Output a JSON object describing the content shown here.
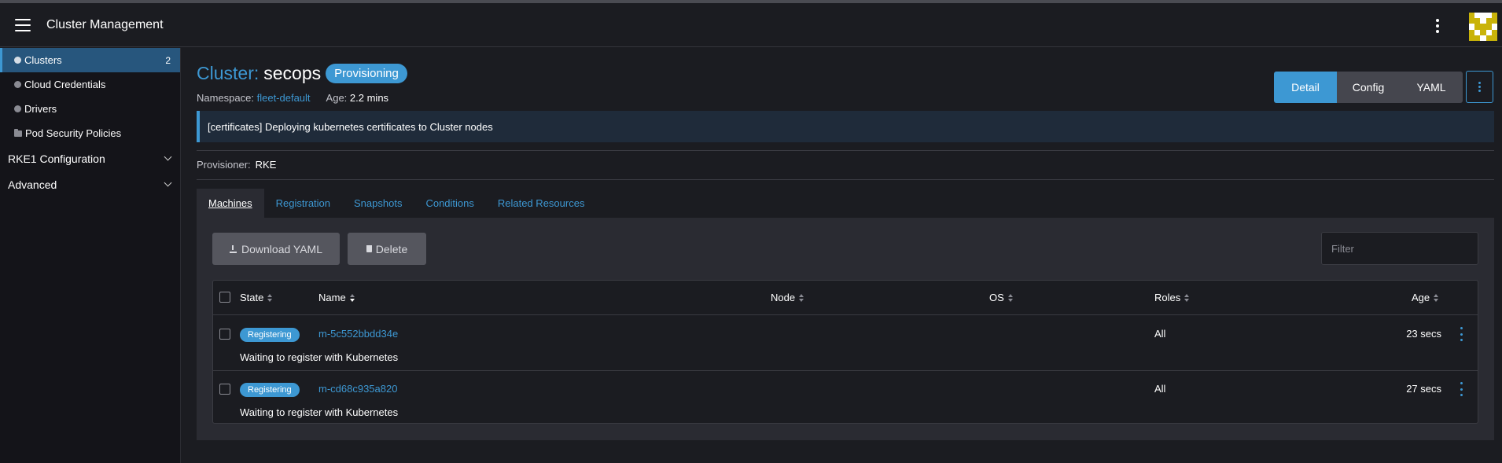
{
  "header": {
    "app_title": "Cluster Management"
  },
  "sidebar": {
    "items": [
      {
        "label": "Clusters",
        "count": "2"
      },
      {
        "label": "Cloud Credentials"
      },
      {
        "label": "Drivers"
      },
      {
        "label": "Pod Security Policies"
      }
    ],
    "groups": [
      {
        "label": "RKE1 Configuration"
      },
      {
        "label": "Advanced"
      }
    ]
  },
  "page": {
    "title_prefix": "Cluster:",
    "title_name": "secops",
    "state": "Provisioning",
    "namespace_label": "Namespace:",
    "namespace_value": "fleet-default",
    "age_label": "Age:",
    "age_value": "2.2 mins",
    "view_modes": {
      "detail": "Detail",
      "config": "Config",
      "yaml": "YAML"
    },
    "banner": "[certificates] Deploying kubernetes certificates to Cluster nodes",
    "provisioner_label": "Provisioner:",
    "provisioner_value": "RKE"
  },
  "tabs": [
    "Machines",
    "Registration",
    "Snapshots",
    "Conditions",
    "Related Resources"
  ],
  "toolbar": {
    "download_label": "Download YAML",
    "delete_label": "Delete",
    "filter_placeholder": "Filter"
  },
  "table": {
    "columns": [
      "State",
      "Name",
      "Node",
      "OS",
      "Roles",
      "Age"
    ],
    "rows": [
      {
        "state": "Registering",
        "name": "m-5c552bbdd34e",
        "roles": "All",
        "age": "23 secs",
        "message": "Waiting to register with Kubernetes"
      },
      {
        "state": "Registering",
        "name": "m-cd68c935a820",
        "roles": "All",
        "age": "27 secs",
        "message": "Waiting to register with Kubernetes"
      }
    ]
  },
  "colors": {
    "accent": "#3d98d3",
    "background": "#1b1c21",
    "sidebar": "#141419",
    "panel": "#2a2b32"
  },
  "icons": [
    "hamburger-icon",
    "kebab-icon",
    "avatar-identicon",
    "cluster-icon",
    "folder-icon",
    "chevron-down-icon",
    "download-icon",
    "trash-icon",
    "sort-icon"
  ]
}
